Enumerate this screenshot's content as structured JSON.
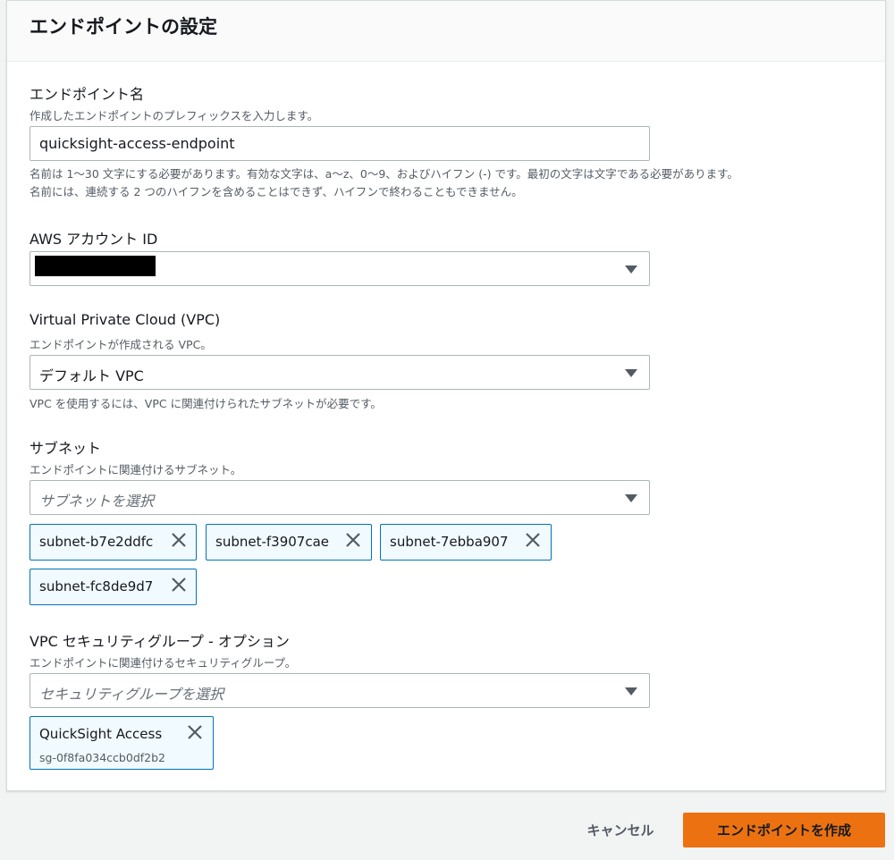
{
  "panel": {
    "title": "エンドポイントの設定"
  },
  "endpoint_name": {
    "label": "エンドポイント名",
    "description": "作成したエンドポイントのプレフィックスを入力します。",
    "value": "quicksight-access-endpoint",
    "hint_line1": "名前は 1〜30 文字にする必要があります。有効な文字は、a〜z、0〜9、およびハイフン (-) です。最初の文字は文字である必要があります。",
    "hint_line2": "名前には、連続する 2 つのハイフンを含めることはできず、ハイフンで終わることもできません。"
  },
  "account": {
    "label": "AWS アカウント ID"
  },
  "vpc": {
    "label": "Virtual Private Cloud (VPC)",
    "description": "エンドポイントが作成される VPC。",
    "value": "デフォルト VPC",
    "hint": "VPC を使用するには、VPC に関連付けられたサブネットが必要です。"
  },
  "subnet": {
    "label": "サブネット",
    "description": "エンドポイントに関連付けるサブネット。",
    "placeholder": "サブネットを選択",
    "tokens": [
      "subnet-b7e2ddfc",
      "subnet-f3907cae",
      "subnet-7ebba907",
      "subnet-fc8de9d7"
    ]
  },
  "security_group": {
    "label": "VPC セキュリティグループ - オプション",
    "description": "エンドポイントに関連付けるセキュリティグループ。",
    "placeholder": "セキュリティグループを選択",
    "tokens": [
      {
        "name": "QuickSight Access",
        "id": "sg-0f8fa034ccb0df2b2"
      }
    ]
  },
  "actions": {
    "cancel_label": "キャンセル",
    "create_label": "エンドポイントを作成"
  },
  "colors": {
    "accent": "#ec7211",
    "token_border": "#0073bb",
    "token_bg": "#f1faff"
  },
  "icons": {
    "remove": "close-icon",
    "dropdown": "caret-down-icon"
  }
}
